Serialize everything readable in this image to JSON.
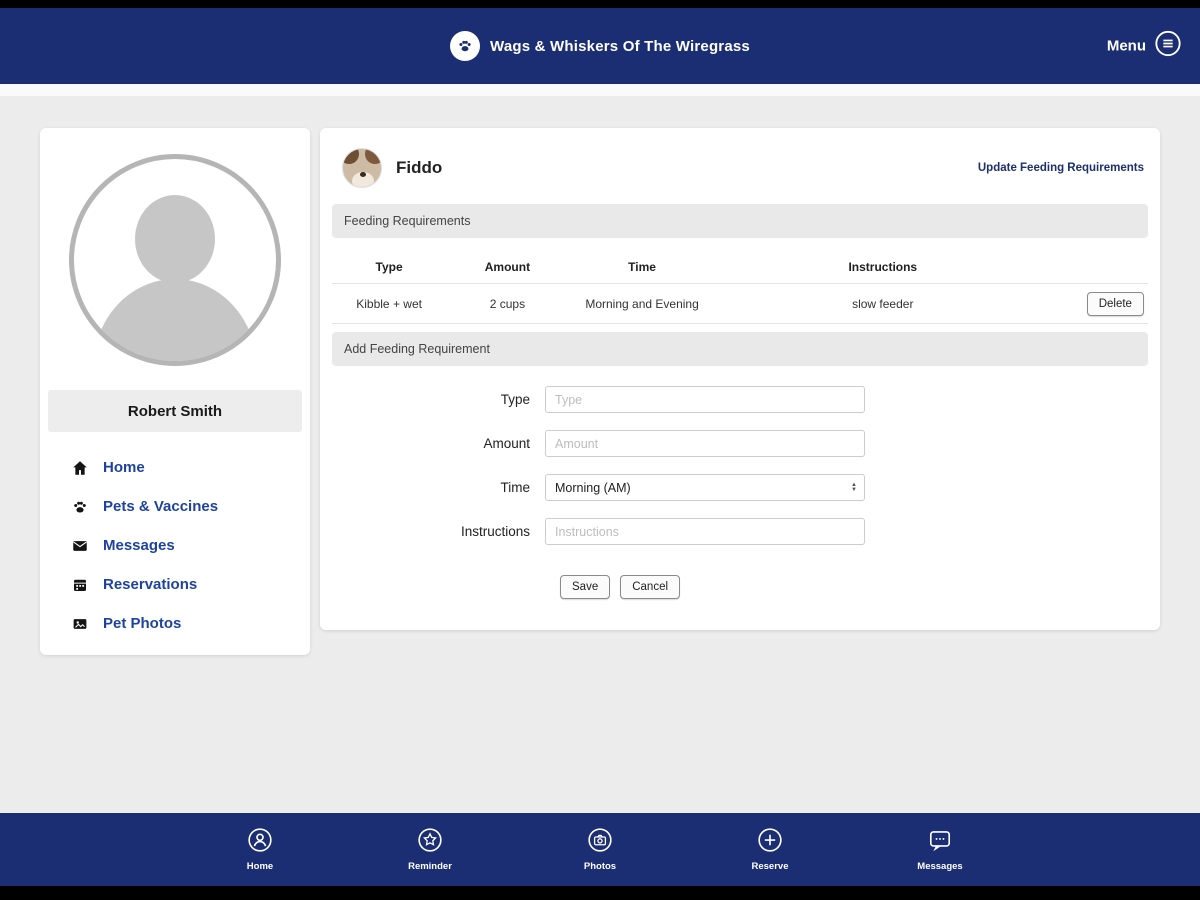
{
  "header": {
    "title": "Wags & Whiskers Of The Wiregrass",
    "menu_label": "Menu"
  },
  "sidebar": {
    "user_name": "Robert Smith",
    "items": [
      {
        "label": "Home",
        "icon": "home-icon"
      },
      {
        "label": "Pets & Vaccines",
        "icon": "paw-icon"
      },
      {
        "label": "Messages",
        "icon": "envelope-icon"
      },
      {
        "label": "Reservations",
        "icon": "calendar-icon"
      },
      {
        "label": "Pet Photos",
        "icon": "photo-icon"
      }
    ]
  },
  "main": {
    "pet_name": "Fiddo",
    "update_link": "Update Feeding Requirements",
    "section_feeding": "Feeding Requirements",
    "table": {
      "headers": [
        "Type",
        "Amount",
        "Time",
        "Instructions"
      ],
      "rows": [
        {
          "cells": [
            "Kibble + wet",
            "2 cups",
            "Morning and Evening",
            "slow feeder"
          ],
          "action": "Delete"
        }
      ]
    },
    "section_add": "Add Feeding Requirement",
    "form": {
      "type_label": "Type",
      "type_placeholder": "Type",
      "amount_label": "Amount",
      "amount_placeholder": "Amount",
      "time_label": "Time",
      "time_value": "Morning (AM)",
      "instructions_label": "Instructions",
      "instructions_placeholder": "Instructions",
      "save_label": "Save",
      "cancel_label": "Cancel"
    }
  },
  "footer": {
    "items": [
      {
        "label": "Home",
        "icon": "person-icon"
      },
      {
        "label": "Reminder",
        "icon": "star-icon"
      },
      {
        "label": "Photos",
        "icon": "camera-icon"
      },
      {
        "label": "Reserve",
        "icon": "plus-icon"
      },
      {
        "label": "Messages",
        "icon": "chat-icon"
      }
    ]
  },
  "colors": {
    "navy": "#1b2e74",
    "link_blue": "#1e429f",
    "background": "#ececec"
  }
}
